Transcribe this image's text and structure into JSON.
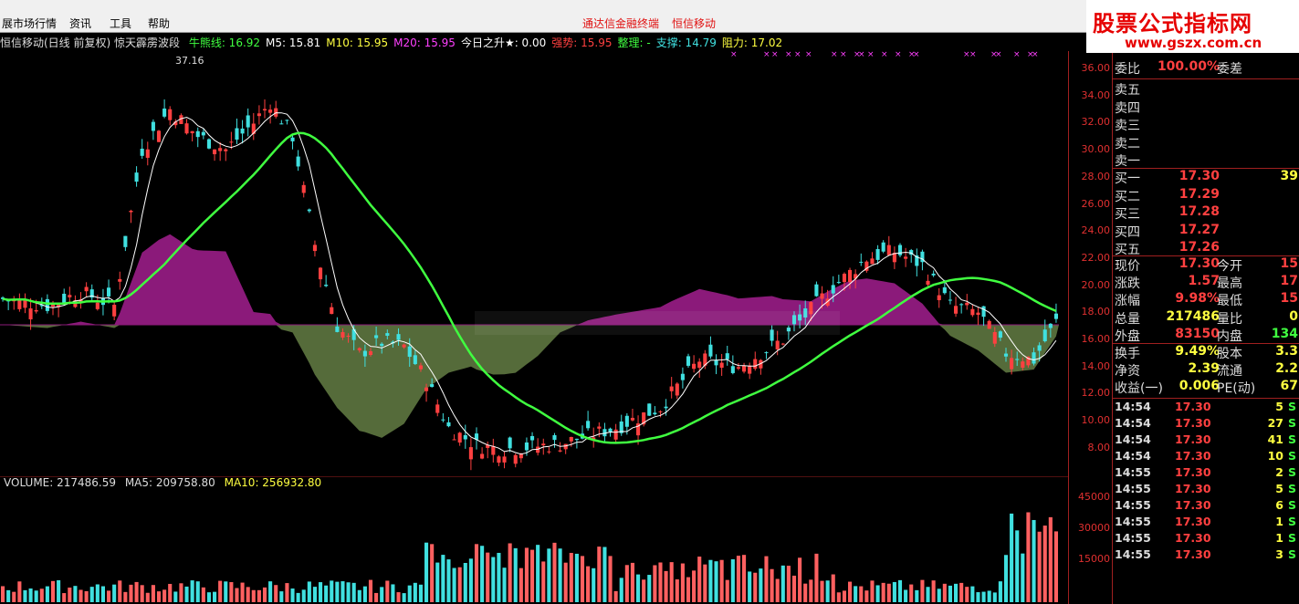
{
  "menu": {
    "items": [
      "展市场行情",
      "资讯",
      "工具",
      "帮助"
    ],
    "center_titles": [
      "通达信金融终端",
      "恒信移动"
    ]
  },
  "brand": {
    "name": "股票公式指标网",
    "url": "www.gszx.com.cn"
  },
  "indicator_line": {
    "stock": "恒信移动(日线 前复权) 惊天霹雳波段",
    "items": [
      {
        "label": "牛熊线: 16.92",
        "color": "#40ff40"
      },
      {
        "label": "M5: 15.81",
        "color": "#ffffff"
      },
      {
        "label": "M10: 15.95",
        "color": "#ffff40"
      },
      {
        "label": "M20: 15.95",
        "color": "#ff40ff"
      },
      {
        "label": "今日之升★: 0.00",
        "color": "#ffffff"
      },
      {
        "label": "强势: 15.95",
        "color": "#ff4040"
      },
      {
        "label": "整理: -",
        "color": "#40ff40"
      },
      {
        "label": "支撑: 14.79",
        "color": "#40e0e0"
      },
      {
        "label": "阻力: 17.02",
        "color": "#ffff40"
      }
    ]
  },
  "price_axis": [
    "36.00",
    "34.00",
    "32.00",
    "30.00",
    "28.00",
    "26.00",
    "24.00",
    "22.00",
    "20.00",
    "18.00",
    "16.00",
    "14.00",
    "12.00",
    "10.00",
    "8.00"
  ],
  "high_marker": "37.16",
  "volume_axis": [
    "45000",
    "30000",
    "15000"
  ],
  "volume_header": {
    "volume": "VOLUME: 217486.59",
    "ma5": "MA5: 209758.80",
    "ma10": "MA10: 256932.80"
  },
  "panel": {
    "weibi": {
      "k": "委比",
      "v": "100.00%",
      "k2": "委差",
      "v2": ""
    },
    "sells": [
      "卖五",
      "卖四",
      "卖三",
      "卖二",
      "卖一"
    ],
    "buys": [
      {
        "k": "买一",
        "v": "17.30",
        "v2": "39"
      },
      {
        "k": "买二",
        "v": "17.29",
        "v2": ""
      },
      {
        "k": "买三",
        "v": "17.28",
        "v2": ""
      },
      {
        "k": "买四",
        "v": "17.27",
        "v2": ""
      },
      {
        "k": "买五",
        "v": "17.26",
        "v2": ""
      }
    ],
    "stats": [
      {
        "k": "现价",
        "v": "17.30",
        "vc": "#ff4040",
        "k2": "今开",
        "v2": "15",
        "v2c": "#ff4040"
      },
      {
        "k": "涨跌",
        "v": "1.57",
        "vc": "#ff4040",
        "k2": "最高",
        "v2": "17",
        "v2c": "#ff4040"
      },
      {
        "k": "涨幅",
        "v": "9.98%",
        "vc": "#ff4040",
        "k2": "最低",
        "v2": "15",
        "v2c": "#ff4040"
      },
      {
        "k": "总量",
        "v": "217486",
        "vc": "#ffff40",
        "k2": "量比",
        "v2": "0",
        "v2c": "#ffff40"
      },
      {
        "k": "外盘",
        "v": "83150",
        "vc": "#ff4040",
        "k2": "内盘",
        "v2": "134",
        "v2c": "#40ff40"
      }
    ],
    "stats2": [
      {
        "k": "换手",
        "v": "9.49%",
        "vc": "#ffff40",
        "k2": "股本",
        "v2": "3.3",
        "v2c": "#ffff40"
      },
      {
        "k": "净资",
        "v": "2.39",
        "vc": "#ffff40",
        "k2": "流通",
        "v2": "2.2",
        "v2c": "#ffff40"
      },
      {
        "k": "收益(一)",
        "v": "0.006",
        "vc": "#ffff40",
        "k2": "PE(动)",
        "v2": "67",
        "v2c": "#ffff40"
      }
    ],
    "ticks": [
      {
        "t": "14:54",
        "p": "17.30",
        "n": "5",
        "s": "S"
      },
      {
        "t": "14:54",
        "p": "17.30",
        "n": "27",
        "s": "S"
      },
      {
        "t": "14:54",
        "p": "17.30",
        "n": "41",
        "s": "S"
      },
      {
        "t": "14:54",
        "p": "17.30",
        "n": "10",
        "s": "S"
      },
      {
        "t": "14:55",
        "p": "17.30",
        "n": "2",
        "s": "S"
      },
      {
        "t": "14:55",
        "p": "17.30",
        "n": "5",
        "s": "S"
      },
      {
        "t": "14:55",
        "p": "17.30",
        "n": "6",
        "s": "S"
      },
      {
        "t": "14:55",
        "p": "17.30",
        "n": "1",
        "s": "S"
      },
      {
        "t": "14:55",
        "p": "17.30",
        "n": "1",
        "s": "S"
      },
      {
        "t": "14:55",
        "p": "17.30",
        "n": "3",
        "s": "S"
      }
    ]
  },
  "colors": {
    "up": "#ff4040",
    "down": "#40e0e0",
    "ma_green": "#40ff40",
    "ma_white": "#ffffff",
    "area_pos": "#8b1a7a",
    "area_neg": "#556b3a"
  }
}
